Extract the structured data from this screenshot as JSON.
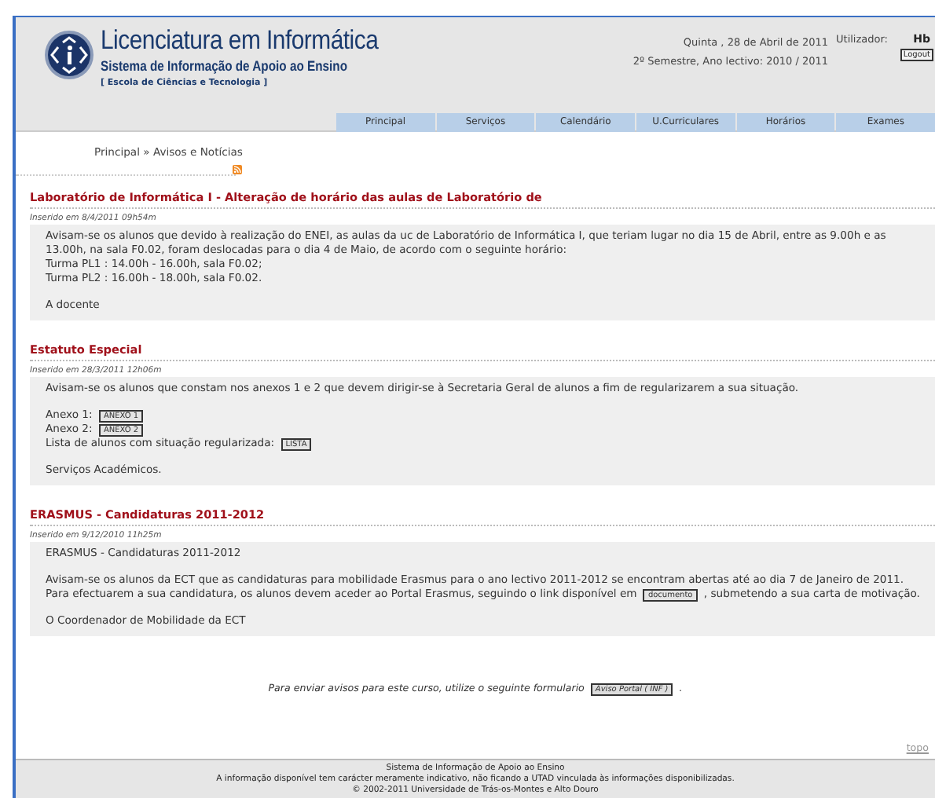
{
  "header": {
    "title": "Licenciatura em Informática",
    "subtitle": "Sistema de Informação de Apoio ao Ensino",
    "school": "[ Escola de Ciências e Tecnologia ]",
    "date": "Quinta , 28 de Abril de 2011",
    "semester": "2º Semestre, Ano lectivo: 2010 / 2011",
    "user_label": "Utilizador:",
    "user": "Hb",
    "logout": "Logout"
  },
  "nav": [
    {
      "label": "Principal"
    },
    {
      "label": "Serviços"
    },
    {
      "label": "Calendário"
    },
    {
      "label": "U.Curriculares"
    },
    {
      "label": "Horários"
    },
    {
      "label": "Exames"
    }
  ],
  "breadcrumb": "Principal » Avisos e Notícias",
  "news": [
    {
      "title": "Laboratório de Informática I - Alteração de horário das aulas de Laboratório de",
      "meta": "Inserido em 8/4/2011 09h54m",
      "paragraphs": [
        [
          {
            "text": "Avisam-se os alunos que devido à realização do ENEI, as aulas da uc de Laboratório de Informática I, que teriam lugar no dia 15 de Abril, entre as 9.00h e as 13.00h, na sala F0.02, foram deslocadas para o dia 4 de Maio, de acordo com o seguinte horário:"
          },
          {
            "text": "Turma PL1 : 14.00h - 16.00h, sala F0.02;"
          },
          {
            "text": "Turma PL2 : 16.00h - 18.00h, sala F0.02."
          }
        ],
        [
          {
            "text": "A docente"
          }
        ]
      ]
    },
    {
      "title": "Estatuto Especial",
      "meta": "Inserido em 28/3/2011 12h06m",
      "paragraphs": [
        [
          {
            "text": "Avisam-se os alunos que constam nos anexos 1 e 2 que devem dirigir-se à Secretaria Geral de alunos a fim de regularizarem a sua situação."
          }
        ],
        [
          {
            "text": "Anexo 1:",
            "button": "ANEXO 1"
          },
          {
            "text": "Anexo 2:",
            "button": "ANEXO 2"
          },
          {
            "text": "Lista de alunos com situação regularizada:",
            "button": "LISTA"
          }
        ],
        [
          {
            "text": "Serviços Académicos."
          }
        ]
      ]
    },
    {
      "title": "ERASMUS - Candidaturas 2011-2012",
      "meta": "Inserido em 9/12/2010 11h25m",
      "paragraphs": [
        [
          {
            "text": "ERASMUS - Candidaturas 2011-2012"
          }
        ],
        [
          {
            "text": "Avisam-se os alunos da ECT que as candidaturas para mobilidade Erasmus para o ano lectivo 2011-2012 se encontram abertas até ao dia 7 de Janeiro de 2011. Para efectuarem a sua candidatura, os alunos devem aceder ao Portal Erasmus, seguindo o link disponível em",
            "button": "documento",
            "after": ", submetendo a sua carta de motivação."
          }
        ],
        [
          {
            "text": "O Coordenador de Mobilidade da ECT"
          }
        ]
      ]
    }
  ],
  "form_note": {
    "text": "Para enviar avisos para este curso, utilize o seguinte formulario",
    "button": "Aviso Portal ( INF )",
    "after": "."
  },
  "top_link": "topo",
  "footer": [
    "Sistema de Informação de Apoio ao Ensino",
    "A informação disponível tem carácter meramente indicativo, não ficando a UTAD vinculada às informações disponibilizadas.",
    "© 2002-2011 Universidade de Trás-os-Montes e Alto Douro"
  ]
}
